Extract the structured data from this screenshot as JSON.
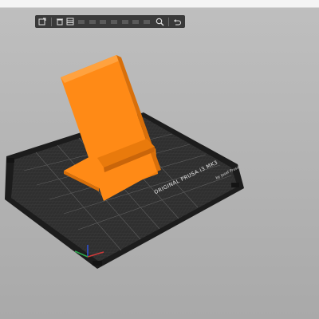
{
  "toolbar": {
    "buttons": [
      {
        "name": "add-object-icon"
      },
      {
        "name": "delete-icon"
      },
      {
        "name": "delete-all-icon"
      },
      {
        "name": "arrange-icon"
      },
      {
        "name": "copy-icon"
      },
      {
        "name": "paste-icon"
      },
      {
        "name": "add-instance-icon"
      },
      {
        "name": "remove-instance-icon"
      },
      {
        "name": "split-icon"
      },
      {
        "name": "layers-icon"
      },
      {
        "name": "search-icon"
      },
      {
        "name": "undo-icon"
      }
    ]
  },
  "bed": {
    "brand_line": "ORIGINAL PRUSA i3 MK3",
    "credit_line": "by Josef Prusa",
    "surface_color": "#2f2f2f",
    "grid_color": "#5a5a5a",
    "frame_color": "#1c1c1c"
  },
  "model": {
    "color": "#ff8a16",
    "shade_color": "#d86f0a",
    "highlight_color": "#ffa23f"
  },
  "axes": {
    "x_color": "#d03a3a",
    "y_color": "#2fa84f",
    "z_color": "#3050d0"
  }
}
